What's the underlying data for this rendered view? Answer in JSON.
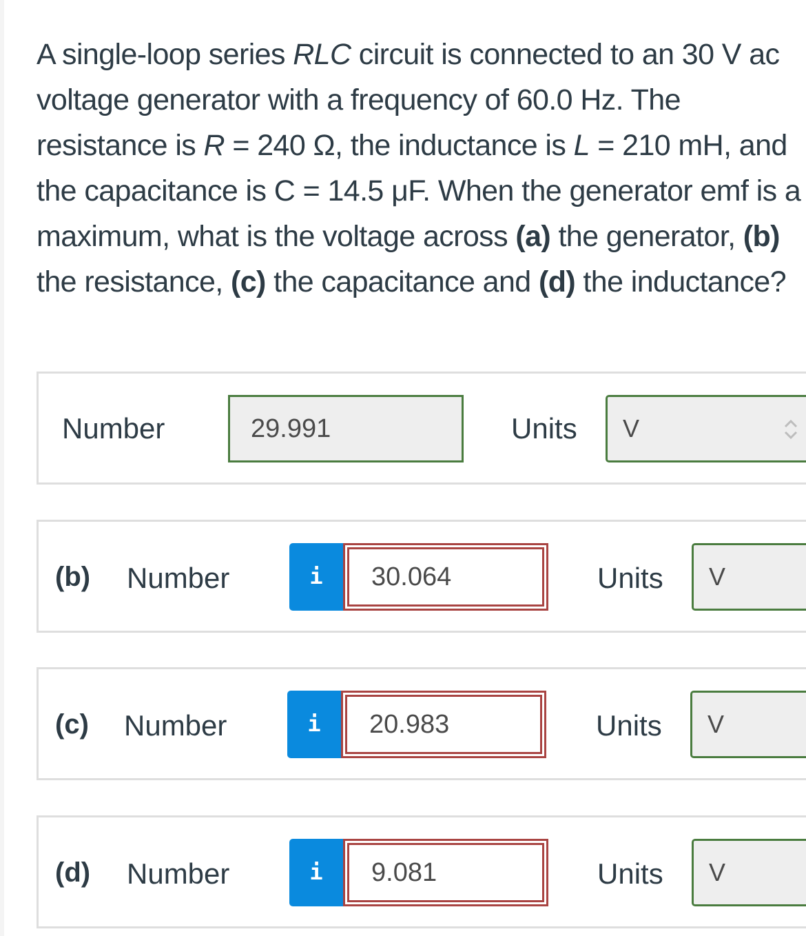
{
  "question": {
    "segments": [
      {
        "t": "A single-loop series ",
        "s": "n"
      },
      {
        "t": "RLC",
        "s": "i"
      },
      {
        "t": " circuit is connected to an 30 V ac voltage generator with a frequency of 60.0 Hz. The resistance is ",
        "s": "n"
      },
      {
        "t": "R",
        "s": "i"
      },
      {
        "t": " = 240 Ω, the inductance is ",
        "s": "n"
      },
      {
        "t": "L",
        "s": "i"
      },
      {
        "t": " = 210 mH, and the capacitance is ",
        "s": "n"
      },
      {
        "t": "C",
        "s": "n"
      },
      {
        "t": " = 14.5 μF. When the generator emf is a maximum, what is the voltage across ",
        "s": "n"
      },
      {
        "t": "(a)",
        "s": "b"
      },
      {
        "t": " the generator, ",
        "s": "n"
      },
      {
        "t": "(b)",
        "s": "b"
      },
      {
        "t": " the resistance, ",
        "s": "n"
      },
      {
        "t": "(c)",
        "s": "b"
      },
      {
        "t": " the capacitance and ",
        "s": "n"
      },
      {
        "t": "(d)",
        "s": "b"
      },
      {
        "t": " the inductance?",
        "s": "n"
      }
    ]
  },
  "parts": {
    "a": {
      "part_label": "",
      "number_label": "Number",
      "value": "29.991",
      "status": "correct",
      "units_label": "Units",
      "units_value": "V"
    },
    "b": {
      "part_label": "(b)",
      "number_label": "Number",
      "value": "30.064",
      "status": "incorrect",
      "units_label": "Units",
      "units_value": "V",
      "info_icon": "i"
    },
    "c": {
      "part_label": "(c)",
      "number_label": "Number",
      "value": "20.983",
      "status": "incorrect",
      "units_label": "Units",
      "units_value": "V",
      "info_icon": "i"
    },
    "d": {
      "part_label": "(d)",
      "number_label": "Number",
      "value": "9.081",
      "status": "incorrect",
      "units_label": "Units",
      "units_value": "V",
      "info_icon": "i"
    }
  },
  "colors": {
    "correct_border": "#4a7c3f",
    "incorrect_border": "#a94442",
    "info_button": "#0a8ade",
    "text": "#2d3b45"
  }
}
